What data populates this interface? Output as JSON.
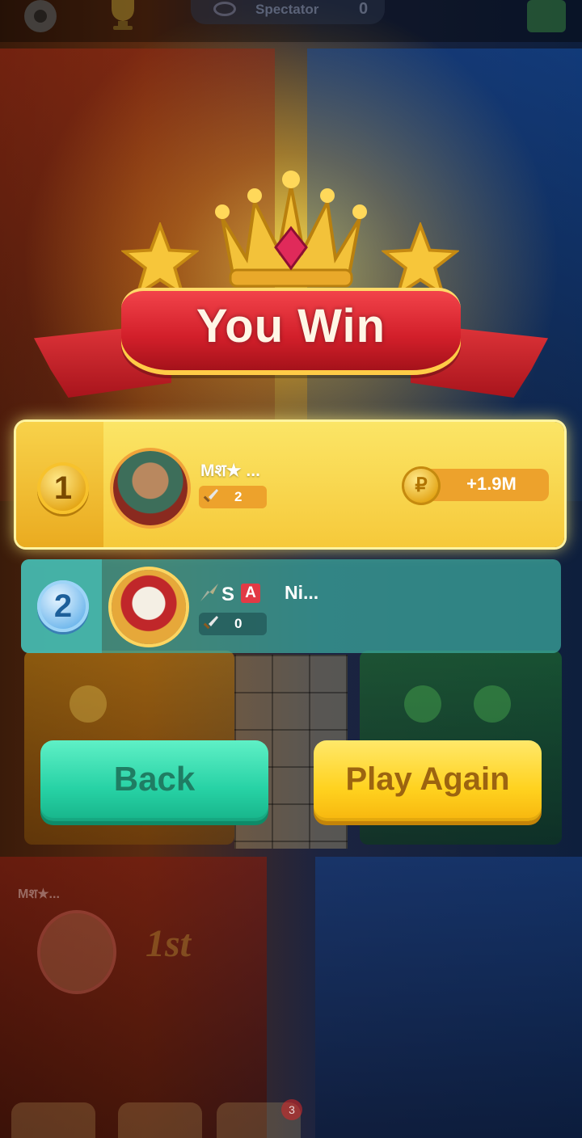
{
  "top_bar": {
    "settings_icon": "gear-icon",
    "trophy_icon": "trophy-icon",
    "spectator_label": "Spectator",
    "spectator_count": "0"
  },
  "banner": {
    "title": "You Win"
  },
  "results": [
    {
      "rank": "1",
      "name": "Mश★ ...",
      "kills": "2",
      "reward": "+1.9M",
      "highlight_color": "#f6c93a"
    },
    {
      "rank": "2",
      "badge_s": "S",
      "badge_a": "A",
      "name": "Ni...",
      "kills": "0"
    }
  ],
  "buttons": {
    "back": "Back",
    "play_again": "Play Again"
  },
  "background": {
    "player_name": "Mश★...",
    "place_label": "1st",
    "chat_badge": "3"
  },
  "colors": {
    "back_button": "#27d2a5",
    "play_button": "#ffd21f",
    "ribbon": "#d21f2a"
  }
}
